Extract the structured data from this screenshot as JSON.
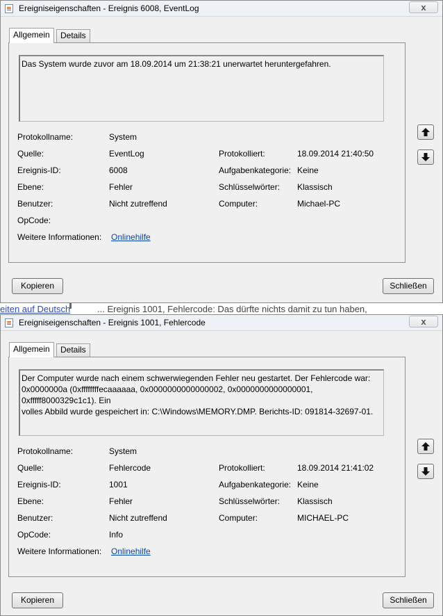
{
  "strip": {
    "link": "eiten auf Deutsch",
    "text": "... Ereignis 1001, Fehlercode: Das dürfte nichts damit zu tun haben,"
  },
  "labels": {
    "protokollname": "Protokollname:",
    "quelle": "Quelle:",
    "ereignis_id": "Ereignis-ID:",
    "ebene": "Ebene:",
    "benutzer": "Benutzer:",
    "opcode": "OpCode:",
    "weitere": "Weitere Informationen:",
    "protokolliert": "Protokolliert:",
    "aufgabenkategorie": "Aufgabenkategorie:",
    "schluesselwoerter": "Schlüsselwörter:",
    "computer": "Computer:"
  },
  "tabs": {
    "general": "Allgemein",
    "details": "Details"
  },
  "buttons": {
    "copy": "Kopieren",
    "close": "Schließen"
  },
  "titlebar_close": "x",
  "icons": {
    "app": "event-properties-icon",
    "up": "arrow-up-icon",
    "down": "arrow-down-icon"
  },
  "dialog1": {
    "title": "Ereigniseigenschaften - Ereignis 6008, EventLog",
    "description": "Das System wurde zuvor am 18.09.2014 um 21:38:21 unerwartet heruntergefahren.",
    "protokollname": "System",
    "quelle": "EventLog",
    "ereignis_id": "6008",
    "ebene": "Fehler",
    "benutzer": "Nicht zutreffend",
    "opcode": "",
    "weitere_link": "Onlinehilfe",
    "protokolliert": "18.09.2014 21:40:50",
    "aufgabenkategorie": "Keine",
    "schluesselwoerter": "Klassisch",
    "computer": "Michael-PC"
  },
  "dialog2": {
    "title": "Ereigniseigenschaften - Ereignis 1001, Fehlercode",
    "description": "Der Computer wurde nach einem schwerwiegenden Fehler neu gestartet. Der Fehlercode war:\n0x0000000a (0xffffffffecaaaaaa, 0x0000000000000002, 0x0000000000000001, 0xfffff8000329c1c1). Ein\nvolles Abbild wurde gespeichert in: C:\\Windows\\MEMORY.DMP. Berichts-ID: 091814-32697-01.",
    "protokollname": "System",
    "quelle": "Fehlercode",
    "ereignis_id": "1001",
    "ebene": "Fehler",
    "benutzer": "Nicht zutreffend",
    "opcode": "Info",
    "weitere_link": "Onlinehilfe",
    "protokolliert": "18.09.2014 21:41:02",
    "aufgabenkategorie": "Keine",
    "schluesselwoerter": "Klassisch",
    "computer": "MICHAEL-PC"
  }
}
